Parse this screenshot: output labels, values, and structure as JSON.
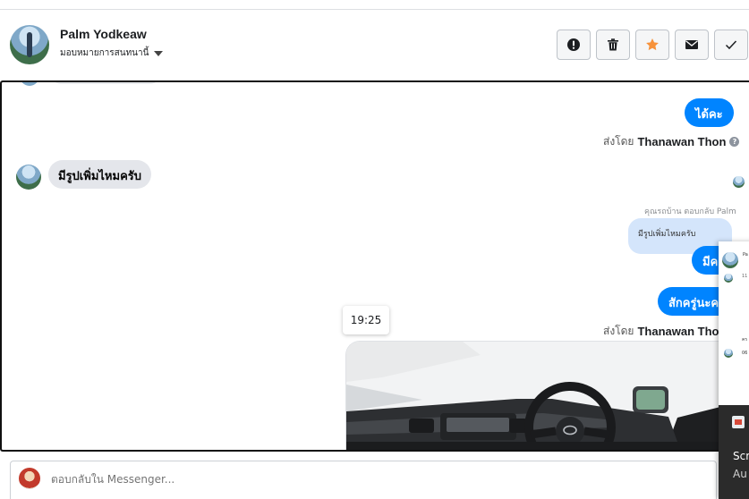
{
  "header": {
    "contact_name": "Palm Yodkeaw",
    "assign_label": "มอบหมายการสนทนานี้"
  },
  "actions": [
    {
      "name": "alert-button",
      "icon": "exclamation-circle-icon"
    },
    {
      "name": "delete-button",
      "icon": "trash-icon"
    },
    {
      "name": "star-button",
      "icon": "star-icon",
      "color": "#f7923b"
    },
    {
      "name": "mail-button",
      "icon": "envelope-icon"
    },
    {
      "name": "done-button",
      "icon": "check-icon"
    }
  ],
  "conversation": {
    "msg1_text": "ได้คะ",
    "sent_by_prefix": "ส่งโดย",
    "sent_by_name": "Thanawan Thon",
    "help_glyph": "?",
    "msg_in_text": "มีรูปเพิ่มไหมครับ",
    "reply_label": "คุณรถบ้าน ตอบกลับ Palm",
    "quoted_text": "มีรูปเพิ่มไหมครับ",
    "msg2_text": "มีคะ",
    "msg3_text": "สักครู่นะคะ",
    "time_tooltip": "19:25",
    "sent_by_name_2": "Thanawan Thon"
  },
  "overlay": {
    "mini_name": "Pa",
    "mini_msg": "คร",
    "mini_time": "06",
    "mini_num": "11",
    "line1": "Scr",
    "line2": "Au"
  },
  "composer": {
    "placeholder": "ตอบกลับใน Messenger..."
  },
  "colors": {
    "accent": "#0084ff",
    "incoming_bubble": "#e4e6eb",
    "quoted_bubble": "#d4e5fb",
    "star": "#f7923b"
  }
}
